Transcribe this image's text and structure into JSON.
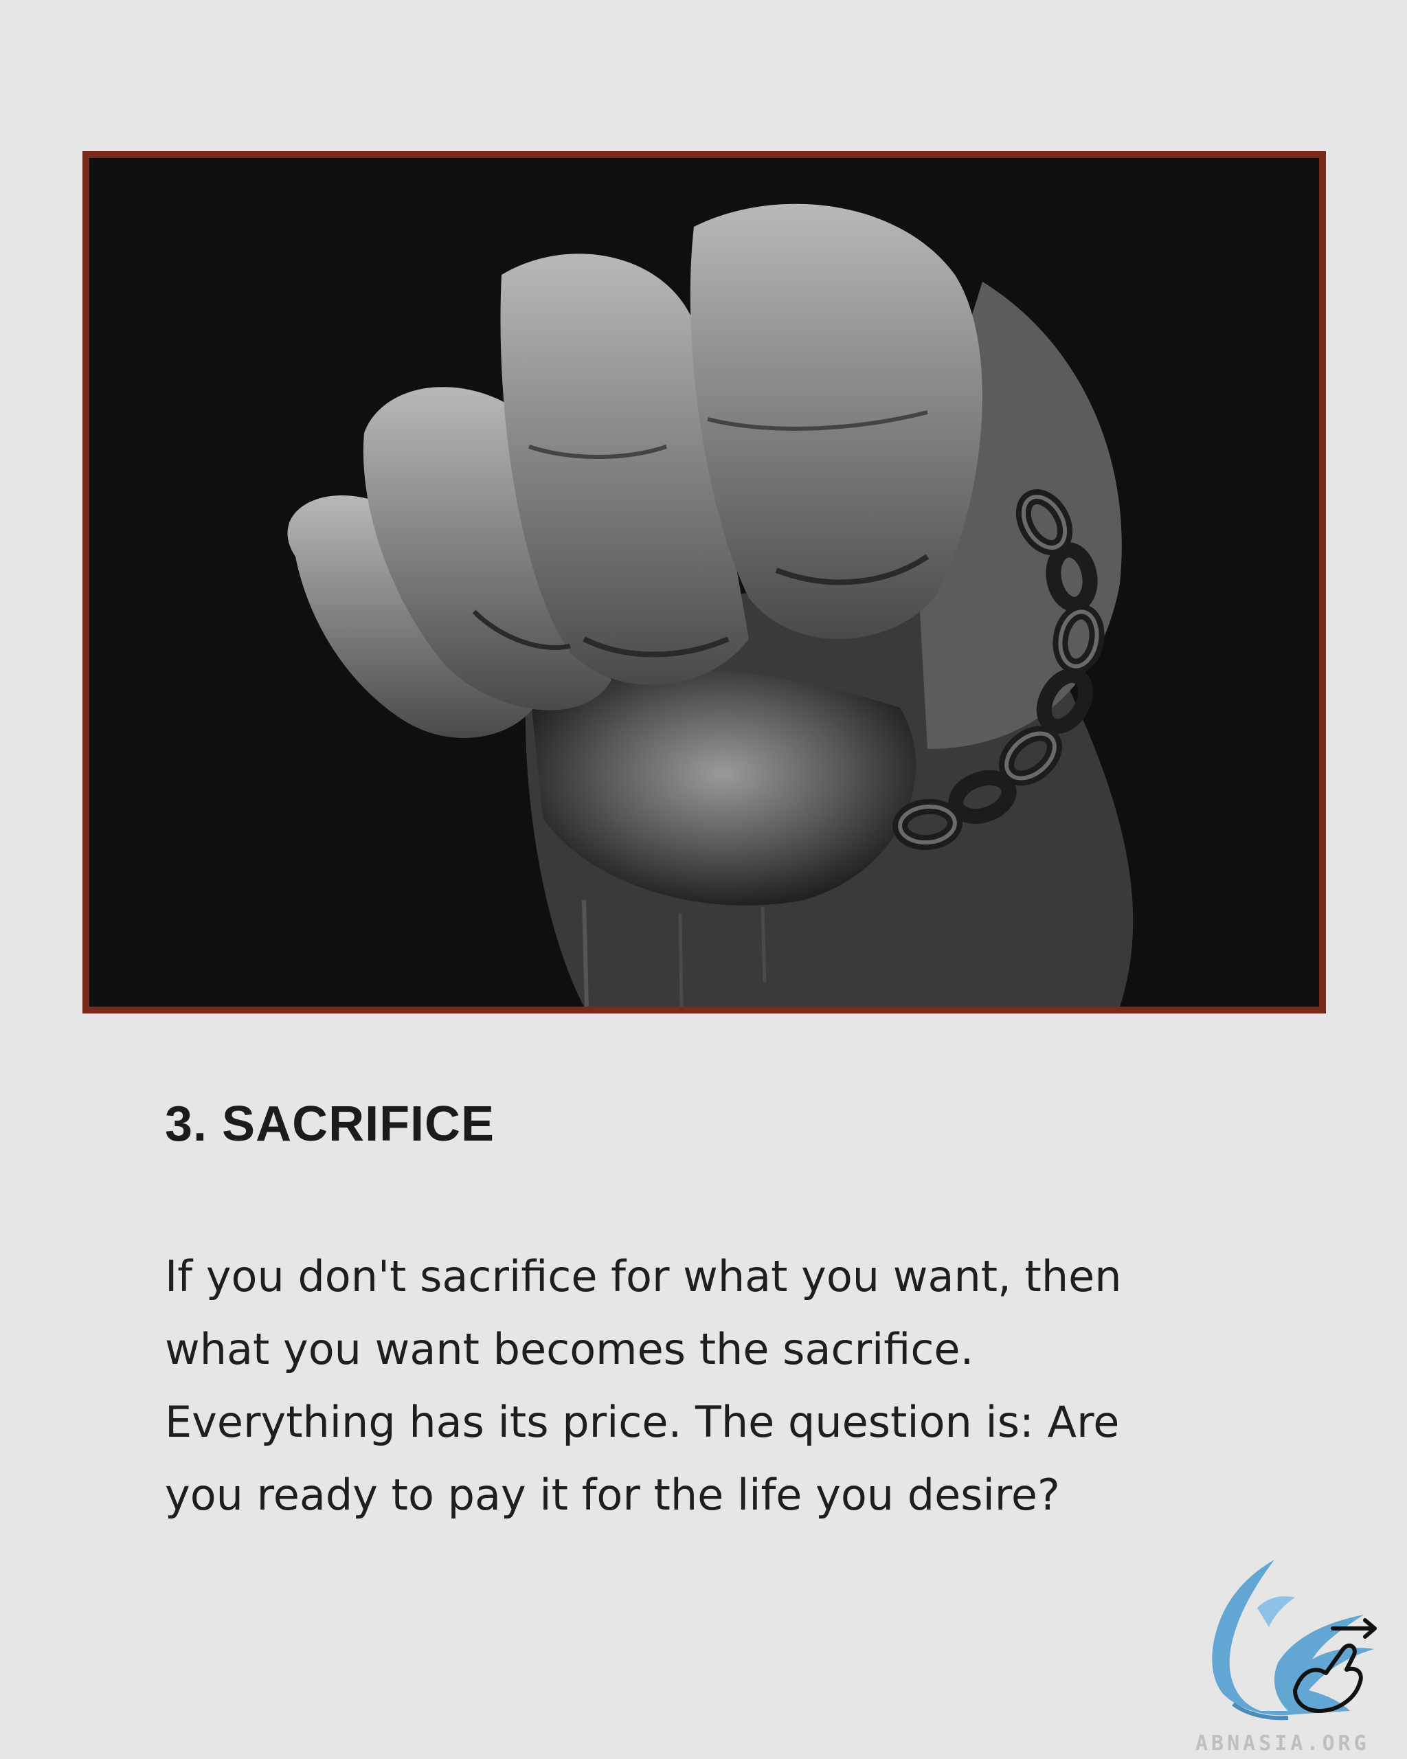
{
  "post": {
    "heading": "3. SACRIFICE",
    "body_lines": [
      "If you don't sacrifice for what you want, then",
      "what you want becomes the sacrifice.",
      "Everything has its price. The question is: Are",
      "you ready to pay it for the life you desire?"
    ]
  },
  "image": {
    "subject": "chained-fist-illustration",
    "frame_color": "#7a2a1a"
  },
  "watermark": {
    "text": "ABNASIA.ORG",
    "icon": "griffin-logo-icon",
    "swipe_icon": "swipe-hand-icon"
  }
}
